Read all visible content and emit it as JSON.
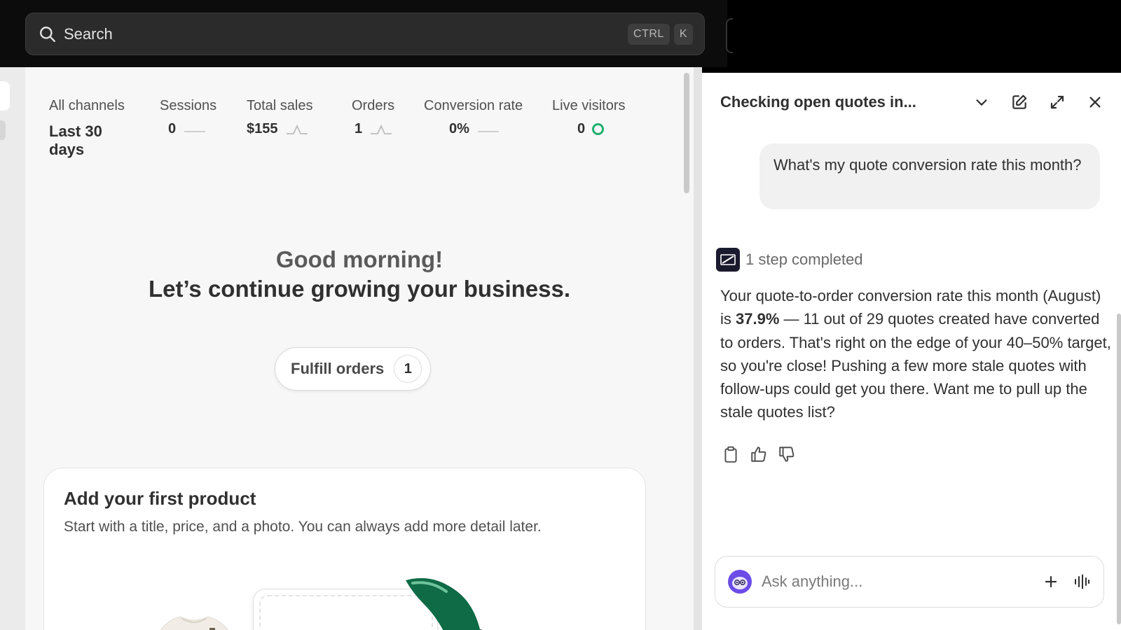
{
  "search": {
    "placeholder": "Search",
    "shortcut_keys": [
      "CTRL",
      "K"
    ]
  },
  "metrics": {
    "channel": {
      "label": "All channels",
      "value": "Last 30 days"
    },
    "items": [
      {
        "label": "Sessions",
        "value": "0"
      },
      {
        "label": "Total sales",
        "value": "$155"
      },
      {
        "label": "Orders",
        "value": "1"
      },
      {
        "label": "Conversion rate",
        "value": "0%"
      },
      {
        "label": "Live visitors",
        "value": "0"
      }
    ],
    "live_color": "#1eb06c"
  },
  "greeting": {
    "line1": "Good morning!",
    "line2": "Let’s continue growing your business."
  },
  "fulfill": {
    "label": "Fulfill orders",
    "count": "1"
  },
  "card": {
    "title": "Add your first product",
    "subtitle": "Start with a title, price, and a photo. You can always add more detail later."
  },
  "assistant": {
    "title": "Checking open quotes in...",
    "user_message": "What's my quote conversion rate this month?",
    "steps_label": "1 step completed",
    "answer": {
      "p1": "Your quote-to-order conversion rate this month (August) is ",
      "rate": "37.9%",
      "p2": " — 11 out of 29 quotes created have converted to orders. That's right on the edge of your 40–50% target, so you're close! Pushing a few more stale quotes with follow-ups could get you there. Want me to pull up the stale quotes list?"
    },
    "input_placeholder": "Ask anything..."
  }
}
